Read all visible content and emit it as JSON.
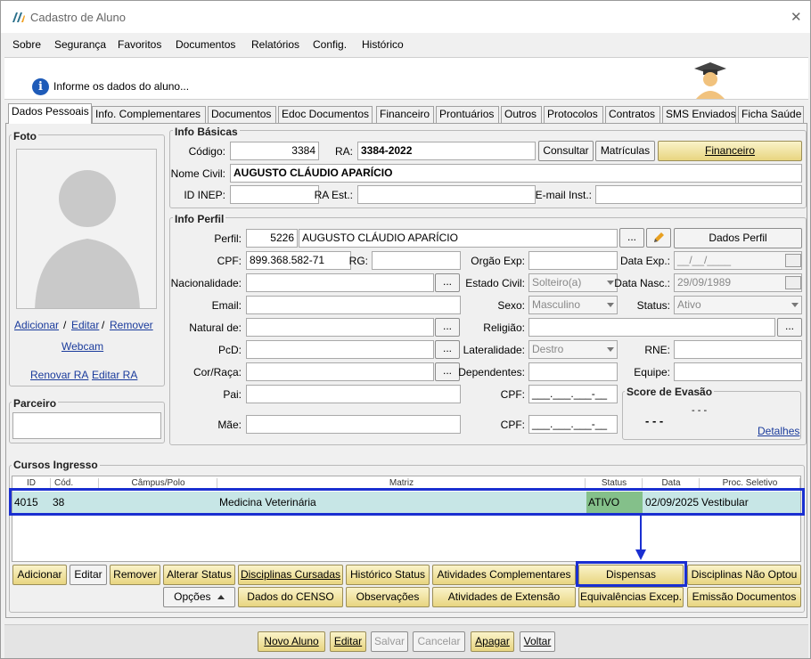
{
  "window": {
    "title": "Cadastro de Aluno",
    "close": "✕"
  },
  "menu": [
    "Sobre",
    "Segurança",
    "Favoritos",
    "Documentos",
    "Relatórios",
    "Config.",
    "Histórico"
  ],
  "banner": {
    "text": "Informe os dados do aluno..."
  },
  "tabs": [
    "Dados Pessoais",
    "Info. Complementares",
    "Documentos",
    "Edoc Documentos",
    "Financeiro",
    "Prontuários",
    "Outros",
    "Protocolos",
    "Contratos",
    "SMS Enviados",
    "Ficha Saúde"
  ],
  "foto": {
    "title": "Foto",
    "adicionar": "Adicionar",
    "sep1": "/",
    "editar": "Editar",
    "sep2": "/",
    "remover": "Remover",
    "webcam": "Webcam",
    "renovar_ra": "Renovar RA",
    "editar_ra": "Editar RA"
  },
  "parceiro": {
    "title": "Parceiro"
  },
  "info_basicas": {
    "title": "Info Básicas",
    "codigo_label": "Código:",
    "codigo": "3384",
    "ra_label": "RA:",
    "ra": "3384-2022",
    "consultar": "Consultar",
    "matriculas": "Matrículas",
    "financeiro": "Financeiro",
    "nome_label": "Nome Civil:",
    "nome": "AUGUSTO CLÁUDIO APARÍCIO",
    "inep_label": "ID INEP:",
    "ra_est_label": "RA Est.:",
    "email_inst_label": "E-mail Inst.:"
  },
  "info_perfil": {
    "title": "Info Perfil",
    "perfil_label": "Perfil:",
    "perfil_id": "5226",
    "perfil_nome": "AUGUSTO CLÁUDIO APARÍCIO",
    "ellipsis": "...",
    "dados_perfil": "Dados Perfil",
    "cpf_label": "CPF:",
    "cpf": "899.368.582-71",
    "rg_label": "RG:",
    "orgao_label": "Orgão Exp:",
    "data_exp_label": "Data Exp.:",
    "data_exp": "__/__/____",
    "nacionalidade_label": "Nacionalidade:",
    "estado_civil_label": "Estado Civil:",
    "estado_civil": "Solteiro(a)",
    "data_nasc_label": "Data Nasc.:",
    "data_nasc": "29/09/1989",
    "email_label": "Email:",
    "sexo_label": "Sexo:",
    "sexo": "Masculino",
    "status_label": "Status:",
    "status": "Ativo",
    "natural_label": "Natural de:",
    "religiao_label": "Religião:",
    "pcd_label": "PcD:",
    "lateralidade_label": "Lateralidade:",
    "lateralidade": "Destro",
    "rne_label": "RNE:",
    "cor_label": "Cor/Raça:",
    "dependentes_label": "Dependentes:",
    "equipe_label": "Equipe:",
    "pai_label": "Pai:",
    "cpf_pai_label": "CPF:",
    "cpf_pai": "___.___.___-__",
    "mae_label": "Mãe:",
    "cpf_mae_label": "CPF:",
    "cpf_mae": "___.___.___-__"
  },
  "evasao": {
    "title": "Score de Evasão",
    "score1": "- - -",
    "score2": "- - -",
    "detalhes": "Detalhes"
  },
  "cursos": {
    "title": "Cursos Ingresso",
    "columns": [
      "ID",
      "Cód.",
      "Câmpus/Polo",
      "Matriz",
      "Status",
      "Data",
      "Proc. Seletivo"
    ],
    "rows": [
      {
        "id": "4015",
        "cod": "38",
        "campus": "",
        "matriz": "Medicina Veterinária",
        "status": "ATIVO",
        "data": "02/09/2025",
        "proc": "Vestibular"
      }
    ]
  },
  "actions_row1": [
    "Adicionar",
    "Editar",
    "Remover",
    "Alterar Status",
    "Disciplinas Cursadas",
    "Histórico Status",
    "Atividades Complementares",
    "Dispensas",
    "Disciplinas Não Optou"
  ],
  "actions_row2": [
    "Opções",
    "Dados do CENSO",
    "Observações",
    "Atividades de Extensão",
    "Equivalências Excep.",
    "Emissão Documentos"
  ],
  "footer": [
    "Novo Aluno",
    "Editar",
    "Salvar",
    "Cancelar",
    "Apagar",
    "Voltar"
  ],
  "colors": {
    "highlight": "#1a2fd1",
    "row": "#c7e6e6",
    "status": "#84c08a",
    "link": "#1a3b9c"
  }
}
